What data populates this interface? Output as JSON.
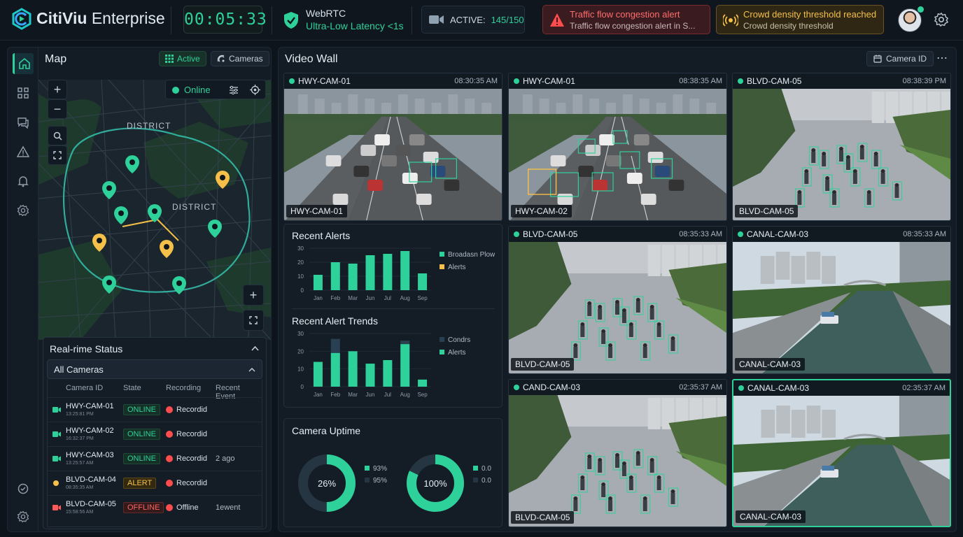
{
  "header": {
    "brand_name": "CitiViu",
    "brand_suffix": "Enterprise",
    "timer": "00:05:33",
    "stream_protocol": "WebRTC",
    "stream_latency": "Ultra-Low Latency <1s",
    "active_label": "ACTIVE:",
    "active_count": "145/150",
    "alerts": [
      {
        "title": "Traffic flow congestion alert",
        "subtitle": "Traffic flow congestion alert in S...",
        "severity": "critical",
        "icon": "warning-icon"
      },
      {
        "title": "Crowd density threshold reached",
        "subtitle": "Crowd density threshold",
        "severity": "warning",
        "icon": "broadcast-icon"
      }
    ]
  },
  "sidebar": {
    "items": [
      {
        "name": "home",
        "icon": "home-icon"
      },
      {
        "name": "grid",
        "icon": "grid-icon"
      },
      {
        "name": "chat",
        "icon": "chat-icon"
      },
      {
        "name": "alerts",
        "icon": "warning-icon"
      },
      {
        "name": "notifications",
        "icon": "bell-icon"
      },
      {
        "name": "settings",
        "icon": "gear-icon"
      },
      {
        "name": "support",
        "icon": "headset-icon"
      },
      {
        "name": "preferences",
        "icon": "gear-icon"
      }
    ]
  },
  "map": {
    "title": "Map",
    "active_label": "Active",
    "cameras_label": "Cameras",
    "online_label": "Online",
    "district_labels": [
      "DISTRICT",
      "DISTRICT"
    ]
  },
  "status": {
    "title": "Real-rime Status",
    "filter": "All Cameras",
    "columns": [
      "Camera ID",
      "State",
      "Recording",
      "Recent Event"
    ],
    "rows": [
      {
        "id": "HWY-CAM-01",
        "time": "13:25:81 PM",
        "state": "ONLINE",
        "state_kind": "online",
        "recording": "Recordid",
        "event": ""
      },
      {
        "id": "HWY-CAM-02",
        "time": "16:32:37 PM",
        "state": "ONLINE",
        "state_kind": "online",
        "recording": "Recordid",
        "event": ""
      },
      {
        "id": "HWY-CAM-03",
        "time": "13:25:57 AM",
        "state": "ONLINE",
        "state_kind": "online",
        "recording": "Recordid",
        "event": "2 ago"
      },
      {
        "id": "BLVD-CAM-04",
        "time": "08:35:35 AM",
        "state": "ALERT",
        "state_kind": "alert",
        "recording": "Recordid",
        "event": ""
      },
      {
        "id": "BLVD-CAM-05",
        "time": "15:58:56 AM",
        "state": "OFFLINE",
        "state_kind": "offline",
        "recording": "Offline",
        "event": "1ewent"
      }
    ]
  },
  "video_wall": {
    "title": "Video Wall",
    "camera_id_button": "Camera ID",
    "more_button": "⋯",
    "tiles": [
      {
        "name": "HWY-CAM-01",
        "time": "08:30:35 AM",
        "label": "HWY-CAM-01",
        "scene": "highway"
      },
      {
        "name": "HWY-CAM-01",
        "time": "08:38:35 AM",
        "label": "HWY-CAM-02",
        "scene": "highway"
      },
      {
        "name": "BLVD-CAM-05",
        "time": "08:38:39 PM",
        "label": "BLVD-CAM-05",
        "scene": "boulevard"
      },
      {
        "name": "BLVD-CAM-05",
        "time": "08:35:33 AM",
        "label": "BLVD-CAM-05",
        "scene": "boulevard"
      },
      {
        "name": "CANAL-CAM-03",
        "time": "08:35:33 AM",
        "label": "CANAL-CAM-03",
        "scene": "canal"
      },
      {
        "name": "CAND-CAM-03",
        "time": "02:35:37 AM",
        "label": "BLVD-CAM-05",
        "scene": "boulevard"
      },
      {
        "name": "CANAL-CAM-03",
        "time": "02:35:37 AM",
        "label": "CANAL-CAM-03",
        "scene": "canal"
      }
    ]
  },
  "uptime": {
    "title": "Camera Uptime",
    "gauges": [
      {
        "value_label": "26%",
        "legend": [
          "93%",
          "95%"
        ]
      },
      {
        "value_label": "100%",
        "legend": [
          "0.0",
          "0.0"
        ]
      }
    ]
  },
  "chart_data": [
    {
      "type": "bar",
      "title": "Recent Alerts",
      "categories": [
        "Jan",
        "Feb",
        "Mar",
        "Jun",
        "Jul",
        "Aug",
        "Sep"
      ],
      "ylim": [
        0,
        30
      ],
      "yticks": [
        0,
        10,
        20,
        30
      ],
      "series": [
        {
          "name": "Broadasn Plow",
          "values": [
            11,
            20,
            19,
            25,
            26,
            28,
            12
          ],
          "color": "#2fd19b"
        },
        {
          "name": "Alerts",
          "values": [
            0,
            0,
            0,
            0,
            0,
            0,
            0
          ],
          "color": "#f5c04a"
        }
      ],
      "legend": "right"
    },
    {
      "type": "bar",
      "title": "Recent Alert Trends",
      "categories": [
        "Jan",
        "Feb",
        "Mar",
        "Jun",
        "Jul",
        "Aug",
        "Sep"
      ],
      "ylim": [
        0,
        30
      ],
      "yticks": [
        0,
        10,
        20,
        30
      ],
      "series": [
        {
          "name": "Condrs",
          "values": [
            0,
            27,
            0,
            0,
            0,
            26,
            0
          ],
          "color": "#284052"
        },
        {
          "name": "Alerts",
          "values": [
            14,
            19,
            20,
            13,
            15,
            24,
            4
          ],
          "color": "#2fd19b"
        }
      ],
      "legend": "right"
    },
    {
      "type": "pie",
      "title": "Camera Uptime",
      "charts": [
        {
          "value": 26,
          "label": "26%",
          "legend": [
            "93%",
            "95%"
          ]
        },
        {
          "value": 100,
          "label": "100%",
          "legend": [
            "0.0",
            "0.0"
          ]
        }
      ]
    }
  ],
  "colors": {
    "accent": "#2fd19b",
    "warning": "#f5c04a",
    "danger": "#ff5a5a",
    "background": "#0e141b",
    "panel": "#131b24"
  }
}
